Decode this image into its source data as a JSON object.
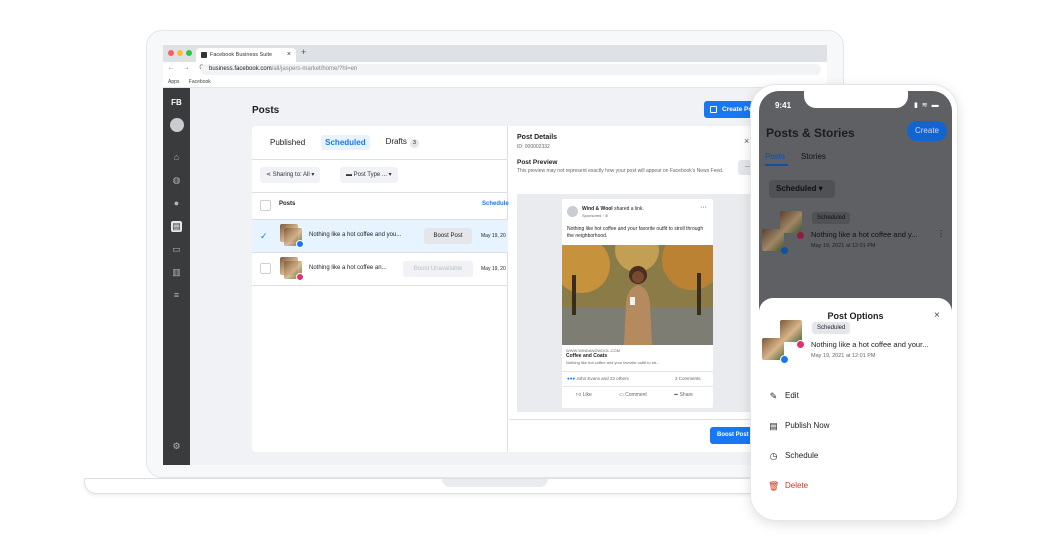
{
  "browser": {
    "tab_title": "Facebook Business Suite",
    "tab_close": "×",
    "new_tab": "+",
    "nav": "← → C",
    "url_host": "business.facebook.com",
    "url_path": "/all/jaspers-market/home/?hl=en",
    "bookmarks": [
      "Apps",
      "Facebook"
    ]
  },
  "sidebar": {
    "logo": "FB"
  },
  "main": {
    "title": "Posts",
    "create_button": "Create Post",
    "tabs": [
      {
        "label": "Published"
      },
      {
        "label": "Scheduled"
      },
      {
        "label": "Drafts",
        "count": "3"
      }
    ],
    "filters": [
      {
        "label": "Sharing to: All"
      },
      {
        "label": "Post Type ..."
      }
    ],
    "table": {
      "col_posts": "Posts",
      "col_schedule": "Schedule",
      "rows": [
        {
          "text": "Nothing like a hot coffee and you...",
          "action": "Boost Post",
          "date": "May 19, 20",
          "checked": true,
          "platform": "facebook"
        },
        {
          "text": "Nothing like a hot coffee an...",
          "action": "Boost Unavailable",
          "date": "May 19, 20",
          "checked": false,
          "platform": "instagram"
        }
      ]
    }
  },
  "details": {
    "title": "Post Details",
    "id": "ID: 000002332",
    "close": "×",
    "preview_title": "Post Preview",
    "preview_note": "This preview may not represent exactly how your post will appear on Facebook's News Feed.",
    "more": "...",
    "post": {
      "author": "Wind & Wool",
      "author_suffix": " shared a link.",
      "sponsored": "Sponsored · ⊘",
      "text": "Nothing like hot coffee and your favorite outfit to stroll through the neighborhood.",
      "domain": "WWW.WINDANDWOOL.COM",
      "headline": "Coffee and Coats",
      "subtext": "Nothing like hot coffee and your favorite outfit to str...",
      "reactions": "John Evans and 23 others",
      "comments": "2 Comments",
      "actions": [
        "Like",
        "Comment",
        "Share"
      ]
    },
    "boost_button": "Boost Post"
  },
  "phone": {
    "time": "9:41",
    "status": "▮ ≋ ▬",
    "title": "Posts & Stories",
    "create": "Create",
    "tabs": [
      "Posts",
      "Stories"
    ],
    "filter": "Scheduled ▾",
    "post": {
      "badge": "Scheduled",
      "text": "Nothing like a hot coffee and y...",
      "date": "May 19, 2021 at 12:01 PM",
      "more": "⋮"
    },
    "sheet": {
      "title": "Post Options",
      "close": "×",
      "badge": "Scheduled",
      "text": "Nothing like a hot coffee and your...",
      "date": "May 19, 2021 at 12:01 PM",
      "options": [
        {
          "label": "Edit",
          "icon": "pencil-icon"
        },
        {
          "label": "Publish Now",
          "icon": "publish-icon"
        },
        {
          "label": "Schedule",
          "icon": "clock-icon"
        },
        {
          "label": "Delete",
          "icon": "trash-icon"
        }
      ]
    }
  },
  "colors": {
    "primary": "#1877f2",
    "sidebar": "#3a3b3c",
    "danger": "#d6311e",
    "instagram": "#e1306c"
  }
}
